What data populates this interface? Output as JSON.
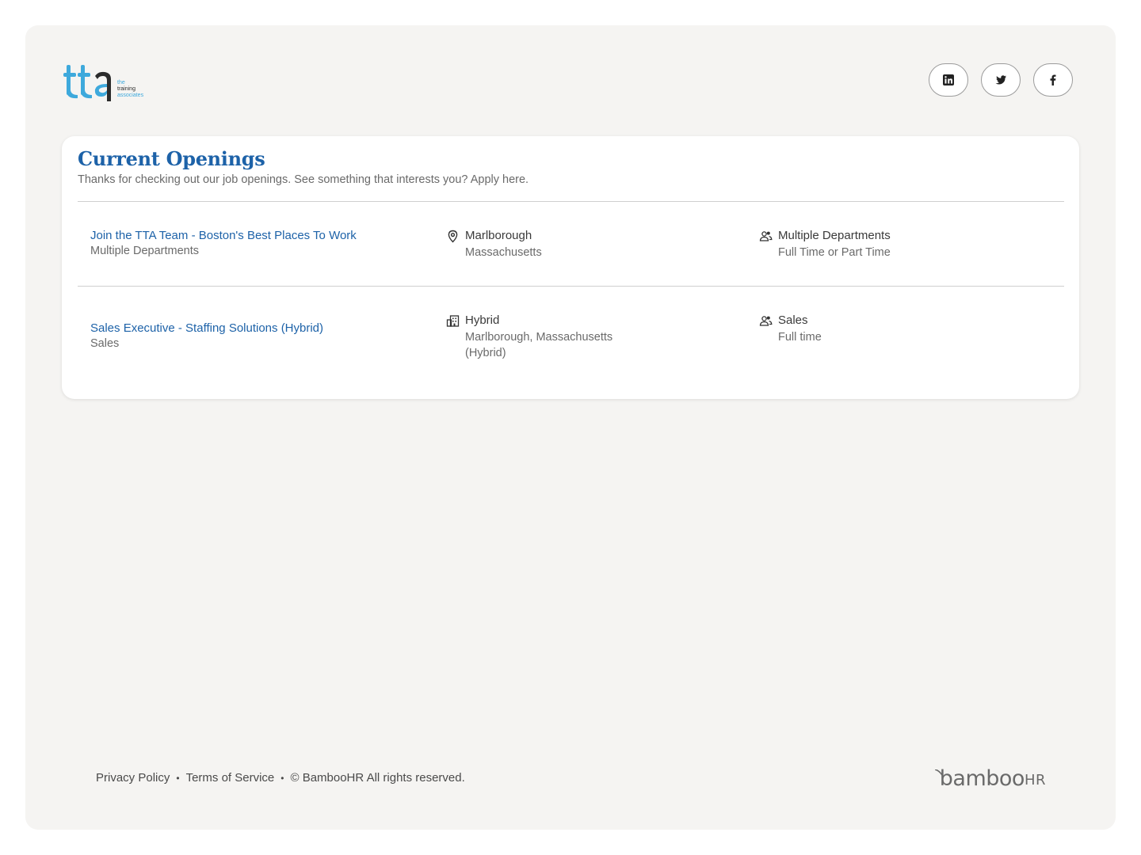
{
  "brand": {
    "logo_text": "tta",
    "logo_sub": [
      "the",
      "training",
      "associates"
    ],
    "accent_color": "#3ea9dc",
    "dark_color": "#2b2b2b"
  },
  "social": [
    {
      "name": "linkedin",
      "icon": "linkedin-icon"
    },
    {
      "name": "twitter",
      "icon": "twitter-icon"
    },
    {
      "name": "facebook",
      "icon": "facebook-icon"
    }
  ],
  "openings": {
    "title": "Current Openings",
    "subtitle": "Thanks for checking out our job openings. See something that interests you? Apply here.",
    "jobs": [
      {
        "title": "Join the TTA Team - Boston's Best Places To Work",
        "department": "Multiple Departments",
        "location_type_icon": "map-pin-icon",
        "location_main": "Marlborough",
        "location_sub": "Massachusetts",
        "team_main": "Multiple Departments",
        "team_sub": "Full Time or Part Time"
      },
      {
        "title": "Sales Executive - Staffing Solutions (Hybrid)",
        "department": "Sales",
        "location_type_icon": "building-icon",
        "location_main": "Hybrid",
        "location_sub": "Marlborough, Massachusetts (Hybrid)",
        "team_main": "Sales",
        "team_sub": "Full time"
      }
    ]
  },
  "footer": {
    "privacy": "Privacy Policy",
    "terms": "Terms of Service",
    "copyright": "© BambooHR All rights reserved.",
    "bamboo_word": "bamboo",
    "bamboo_hr": "HR"
  },
  "colors": {
    "link_blue": "#1d62a8",
    "background": "#f5f4f2",
    "card": "#ffffff"
  }
}
